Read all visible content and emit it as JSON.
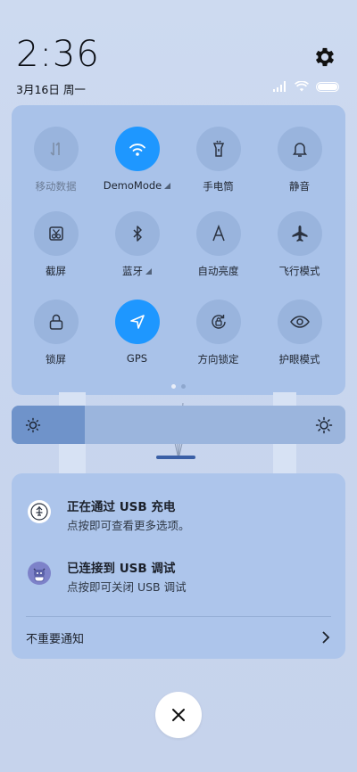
{
  "status_bar": {
    "time": "2:36",
    "date": "3月16日 周一"
  },
  "quick_settings": {
    "tiles": [
      {
        "label": "移动数据",
        "icon": "mobile-data-icon",
        "state": "disabled"
      },
      {
        "label": "DemoMode",
        "icon": "wifi-icon",
        "state": "active"
      },
      {
        "label": "手电筒",
        "icon": "flashlight-icon",
        "state": "off"
      },
      {
        "label": "静音",
        "icon": "bell-icon",
        "state": "off"
      },
      {
        "label": "截屏",
        "icon": "screenshot-icon",
        "state": "off"
      },
      {
        "label": "蓝牙",
        "icon": "bluetooth-icon",
        "state": "off"
      },
      {
        "label": "自动亮度",
        "icon": "auto-brightness-icon",
        "state": "off"
      },
      {
        "label": "飞行模式",
        "icon": "airplane-icon",
        "state": "off"
      },
      {
        "label": "锁屏",
        "icon": "lock-icon",
        "state": "off"
      },
      {
        "label": "GPS",
        "icon": "location-icon",
        "state": "active"
      },
      {
        "label": "方向锁定",
        "icon": "rotation-lock-icon",
        "state": "off"
      },
      {
        "label": "护眼模式",
        "icon": "eye-icon",
        "state": "off"
      }
    ],
    "page_count": 2,
    "current_page": 1
  },
  "brightness": {
    "level": 0.22,
    "low_icon": "sun-small-icon",
    "high_icon": "sun-large-icon"
  },
  "notifications": [
    {
      "title": "正在通过 USB 充电",
      "text": "点按即可查看更多选项。",
      "icon": "usb-charge-icon"
    },
    {
      "title": "已连接到 USB 调试",
      "text": "点按即可关闭 USB 调试",
      "icon": "android-debug-icon"
    }
  ],
  "unimportant_label": "不重要通知",
  "colors": {
    "accent": "#1e97ff",
    "panel": "#a9c2e9",
    "tile_off": "#99b4dd"
  }
}
